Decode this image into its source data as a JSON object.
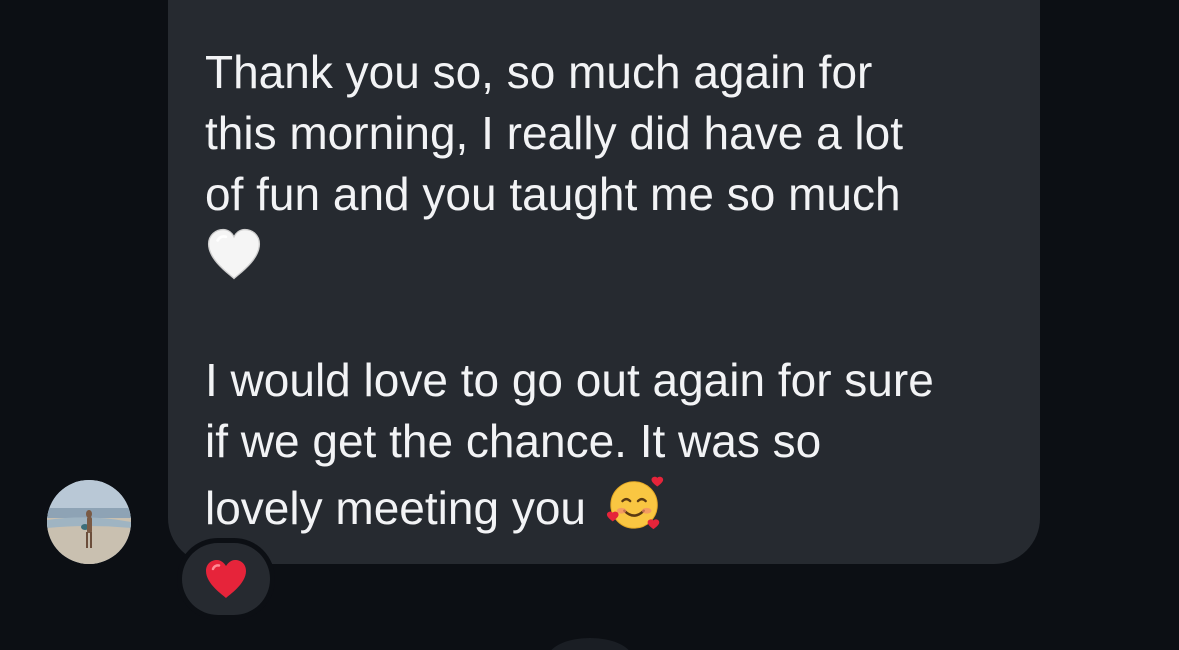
{
  "message": {
    "paragraph_1": {
      "line_1": "Thank you so, so much again for",
      "line_2": "this morning, I really did have a lot",
      "line_3": "of fun and you taught me so much",
      "emoji_line": "🤍"
    },
    "paragraph_2": {
      "line_1": "I would love to go out again for sure",
      "line_2": "if we get the chance. It was so",
      "line_3": "lovely meeting you",
      "end_emoji": "🥰"
    }
  },
  "reaction": {
    "emoji": "❤️",
    "icon": "red-heart-icon"
  },
  "avatar": {
    "icon": "profile-avatar"
  },
  "colors": {
    "background": "#0c0f14",
    "bubble": "#262a30",
    "text": "#f2f3f5",
    "reaction_heart": "#e6243a"
  }
}
